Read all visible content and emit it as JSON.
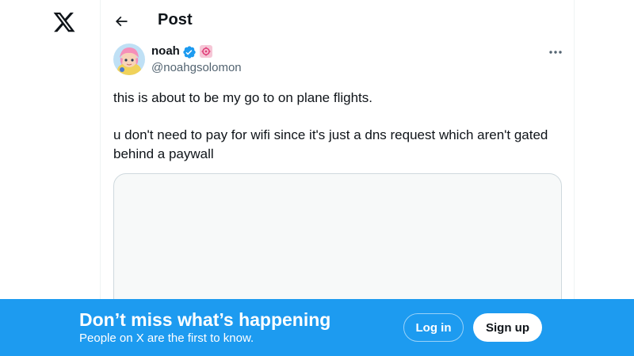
{
  "nav": {
    "logo_icon": "x-logo-icon"
  },
  "header": {
    "back_icon": "arrow-left-icon",
    "title": "Post"
  },
  "tweet": {
    "author": {
      "name": "noah",
      "handle": "@noahgsolomon",
      "verified_icon": "verified-badge-icon",
      "affiliate_badge_icon": "affiliate-badge-icon"
    },
    "more_icon": "more-horizontal-icon",
    "text_line_1": "this is about to be my go to on plane flights.",
    "text_line_2": "u don't need to pay for wifi since it's just a dns request which aren't gated behind a paywall"
  },
  "banner": {
    "title": "Don’t miss what’s happening",
    "subtitle": "People on X are the first to know.",
    "login_label": "Log in",
    "signup_label": "Sign up"
  },
  "colors": {
    "accent": "#1d9bf0",
    "text_primary": "#0f1419",
    "text_secondary": "#536471",
    "border": "#cfd9de"
  }
}
